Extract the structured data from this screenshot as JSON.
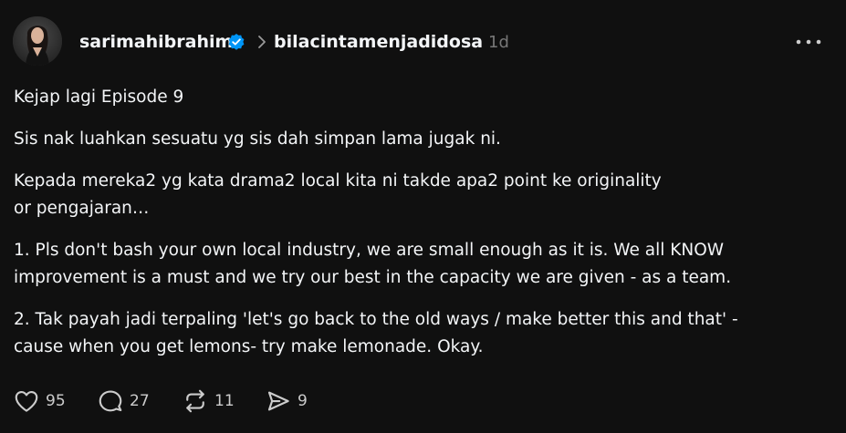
{
  "post": {
    "author": "sarimahibrahim",
    "author_verified": true,
    "community": "bilacintamenjadidosa",
    "time": "1d",
    "paragraphs": [
      "Kejap lagi Episode 9",
      "Sis nak luahkan sesuatu yg sis dah simpan lama jugak ni.",
      "Kepada mereka2 yg kata drama2 local kita ni takde apa2 point ke originality\nor pengajaran…",
      "1. Pls don't bash your own local industry, we are small enough as it is. We all KNOW\nimprovement is a must and we try our best in the capacity we are given - as a team.",
      "2. Tak payah jadi terpaling 'let's go back to the old ways / make better this and that' -\ncause when you get lemons- try make lemonade. Okay."
    ]
  },
  "actions": {
    "likes": "95",
    "replies": "27",
    "reposts": "11",
    "shares": "9"
  },
  "colors": {
    "background": "#101010",
    "text": "#f3f5f7",
    "muted": "#777777",
    "verified": "#0095f6"
  }
}
